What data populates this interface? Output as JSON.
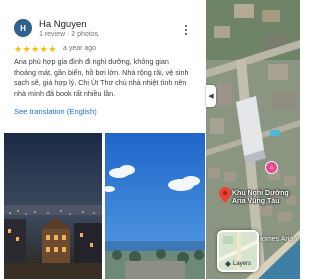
{
  "review": {
    "avatar_initial": "H",
    "reviewer_name": "Ha Nguyen",
    "reviewer_meta": "1 review · 2 photos",
    "rating": 5,
    "time_ago": "a year ago",
    "text": "Aria phù hợp gia đình đi nghỉ dưỡng, không gian thoáng mát, gần biển, hồ bơi lớn. Nhà rộng rãi, vệ sinh sạch sẽ, giá hợp lý. Chị Út Thơ chủ nhà nhiệt tình nên nhà mình đã book rất nhiều lần.",
    "see_translation": "See translation (English)",
    "photos": [
      "night-city-photo",
      "sky-beach-photo"
    ]
  },
  "map": {
    "place_name": "Khu Nghỉ Dưỡng Aria Vũng Tàu",
    "nearby_label": "Homes Aria V",
    "layers_label": "Layers",
    "colors": {
      "pin": "#ea4335",
      "poi": "#e94b8a",
      "link": "#1a73e8",
      "star": "#fbbc04"
    }
  }
}
